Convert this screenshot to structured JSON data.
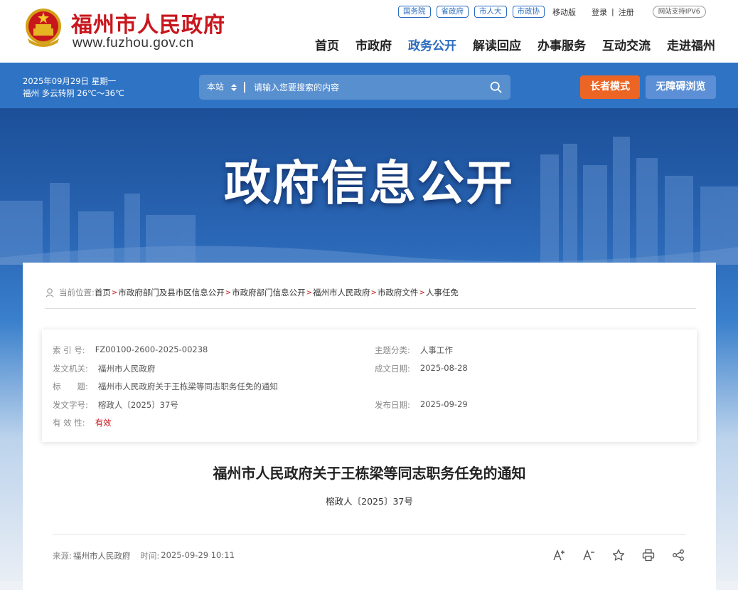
{
  "header": {
    "site_name": "福州市人民政府",
    "site_url": "www.fuzhou.gov.cn",
    "top_links": [
      "国务院",
      "省政府",
      "市人大",
      "市政协"
    ],
    "mobile": "移动版",
    "login": "登录",
    "separator": "|",
    "register": "注册",
    "ipv6": "网站支持IPV6",
    "nav": [
      "首页",
      "市政府",
      "政务公开",
      "解读回应",
      "办事服务",
      "互动交流",
      "走进福州"
    ],
    "active_nav": "政务公开"
  },
  "bar": {
    "date": "2025年09月29日 星期一",
    "weather": "福州 多云转阴 26℃～36℃",
    "search_scope": "本站",
    "search_placeholder": "请输入您要搜索的内容",
    "elder_mode": "长者模式",
    "accessible": "无障碍浏览"
  },
  "banner": {
    "title": "政府信息公开"
  },
  "breadcrumb": {
    "label": "当前位置:",
    "items": [
      "首页",
      "市政府部门及县市区信息公开",
      "市政府部门信息公开",
      "福州市人民政府",
      "市政府文件",
      "人事任免"
    ]
  },
  "meta": {
    "index_label": "索 引 号:",
    "index_value": "FZ00100-2600-2025-00238",
    "topic_label": "主题分类:",
    "topic_value": "人事工作",
    "issuer_label": "发文机关:",
    "issuer_value": "福州市人民政府",
    "date_label": "成文日期:",
    "date_value": "2025-08-28",
    "title_label": "标　　题:",
    "title_value": "福州市人民政府关于王栋梁等同志职务任免的通知",
    "docno_label": "发文字号:",
    "docno_value": "榕政人〔2025〕37号",
    "pub_label": "发布日期:",
    "pub_value": "2025-09-29",
    "valid_label": "有 效 性:",
    "valid_value": "有效"
  },
  "doc": {
    "title": "福州市人民政府关于王栋梁等同志职务任免的通知",
    "number": "榕政人〔2025〕37号",
    "source_label": "来源:",
    "source_value": "福州市人民政府",
    "time_label": "时间:",
    "time_value": "2025-09-29 10:11"
  },
  "colors": {
    "brand_red": "#c8161d",
    "brand_blue": "#2f74c4",
    "orange": "#ec6524"
  }
}
